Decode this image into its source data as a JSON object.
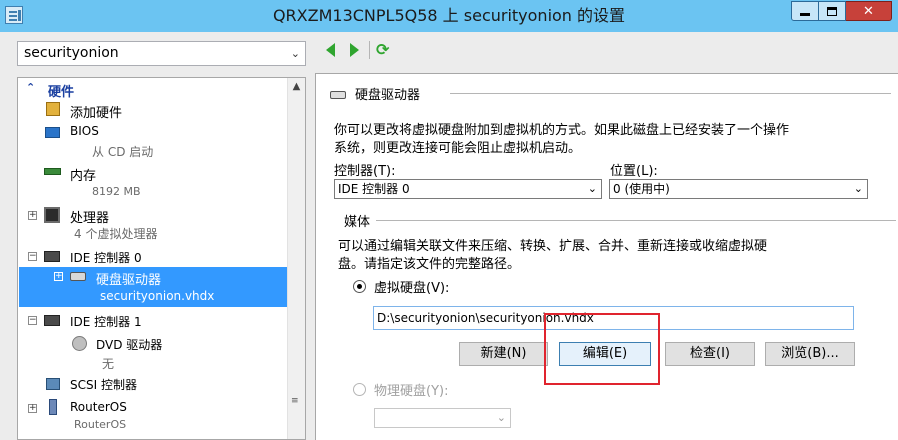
{
  "window": {
    "title": "QRXZM13CNPL5Q58 上 securityonion 的设置"
  },
  "vm_selector": {
    "value": "securityonion"
  },
  "tree": {
    "category": "硬件",
    "items": [
      {
        "label": "添加硬件"
      },
      {
        "label": "BIOS",
        "sub": "从 CD 启动"
      },
      {
        "label": "内存",
        "sub": "8192 MB"
      },
      {
        "label": "处理器",
        "sub": "4 个虚拟处理器"
      },
      {
        "label": "IDE 控制器 0"
      },
      {
        "label": "硬盘驱动器",
        "sub": "securityonion.vhdx"
      },
      {
        "label": "IDE 控制器 1"
      },
      {
        "label": "DVD 驱动器",
        "sub": "无"
      },
      {
        "label": "SCSI 控制器"
      },
      {
        "label": "RouterOS",
        "sub": "RouterOS"
      }
    ]
  },
  "detail": {
    "section_title": "硬盘驱动器",
    "description_1": "你可以更改将虚拟硬盘附加到虚拟机的方式。如果此磁盘上已经安装了一个操作",
    "description_2": "系统，则更改连接可能会阻止虚拟机启动。",
    "controller_label": "控制器(T):",
    "controller_value": "IDE 控制器 0",
    "location_label": "位置(L):",
    "location_value": "0 (使用中)",
    "media_title": "媒体",
    "media_desc_1": "可以通过编辑关联文件来压缩、转换、扩展、合并、重新连接或收缩虚拟硬",
    "media_desc_2": "盘。请指定该文件的完整路径。",
    "virtual_disk_label": "虚拟硬盘(V):",
    "virtual_disk_path": "D:\\securityonion\\securityonion.vhdx",
    "btn_new": "新建(N)",
    "btn_edit": "编辑(E)",
    "btn_inspect": "检查(I)",
    "btn_browse": "浏览(B)...",
    "physical_disk_label": "物理硬盘(Y):"
  },
  "colors": {
    "titlebar": "#6bc4f2",
    "selection": "#3399ff",
    "highlight": "#e0242e"
  }
}
